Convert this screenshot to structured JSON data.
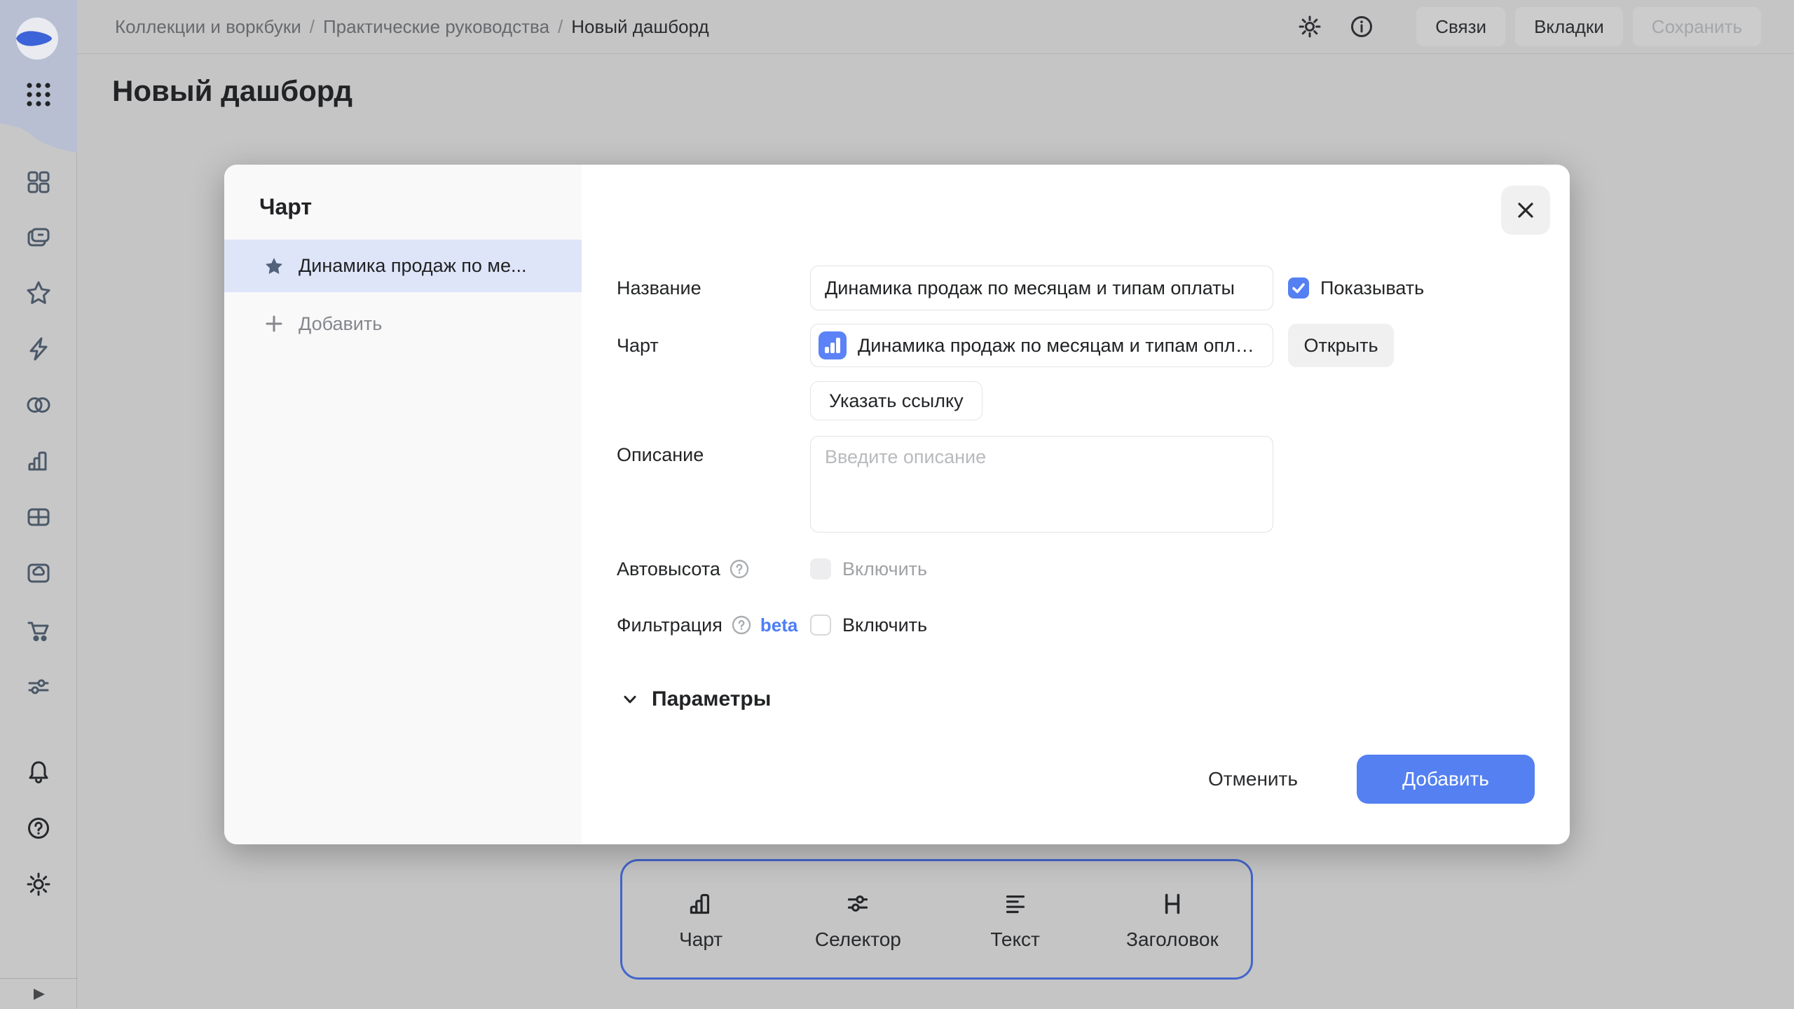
{
  "header": {
    "breadcrumb": [
      "Коллекции и воркбуки",
      "Практические руководства",
      "Новый дашборд"
    ],
    "separator": "/",
    "actions": {
      "links": "Связи",
      "tabs": "Вкладки",
      "save": "Сохранить"
    }
  },
  "page": {
    "title": "Новый дашборд"
  },
  "modal": {
    "panel": {
      "title": "Чарт",
      "selected_item": "Динамика продаж по ме...",
      "add_label": "Добавить"
    },
    "form": {
      "name": {
        "label": "Название",
        "value": "Динамика продаж по месяцам и типам оплаты",
        "show_label": "Показывать"
      },
      "chart": {
        "label": "Чарт",
        "value": "Динамика продаж по месяцам и типам опла...",
        "open_label": "Открыть",
        "link_label": "Указать ссылку"
      },
      "description": {
        "label": "Описание",
        "placeholder": "Введите описание"
      },
      "autoheight": {
        "label": "Автовысота",
        "toggle_label": "Включить"
      },
      "filtering": {
        "label": "Фильтрация",
        "badge": "beta",
        "toggle_label": "Включить"
      }
    },
    "params_label": "Параметры",
    "footer": {
      "cancel": "Отменить",
      "add": "Добавить"
    }
  },
  "toolbar": {
    "items": [
      {
        "label": "Чарт"
      },
      {
        "label": "Селектор"
      },
      {
        "label": "Текст"
      },
      {
        "label": "Заголовок"
      }
    ]
  },
  "colors": {
    "accent_blue": "#5480f2",
    "chart_chip_blue": "#5b82f7",
    "beta_blue": "#4d7ef5",
    "toolbar_border_blue": "#4365cb",
    "selected_item_bg": "#dfe5f9",
    "overlay_gray": "#c5c5c6"
  }
}
